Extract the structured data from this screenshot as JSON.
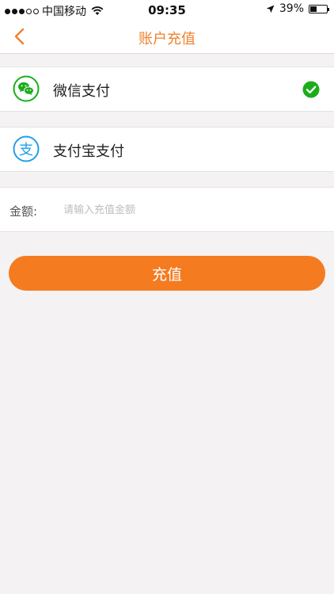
{
  "status_bar": {
    "carrier": "中国移动",
    "time": "09:35",
    "battery": "39%",
    "battery_level": 0.39
  },
  "nav": {
    "title": "账户充值"
  },
  "payment_options": [
    {
      "label": "微信支付",
      "icon": "wechat-pay-icon",
      "selected": true
    },
    {
      "label": "支付宝支付",
      "icon": "alipay-icon",
      "selected": false
    }
  ],
  "amount": {
    "label": "金额:",
    "placeholder": "请输入充值金额",
    "value": ""
  },
  "submit_label": "充值",
  "colors": {
    "accent": "#f47b20",
    "wechat": "#1aad19",
    "alipay": "#1fa0e8",
    "check": "#1aad19"
  }
}
